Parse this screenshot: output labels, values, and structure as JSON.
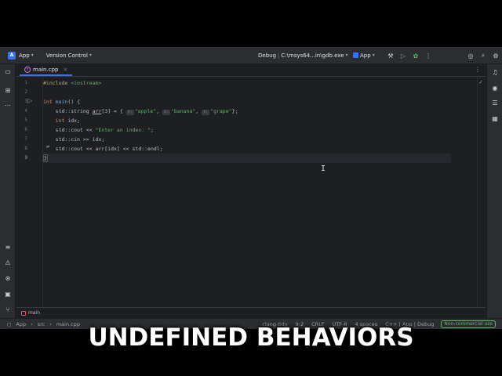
{
  "titlebar": {
    "app_badge": "A",
    "app_name": "App",
    "vcs": "Version Control",
    "config": "Debug",
    "config_path": "C:\\msys64...in\\gdb.exe",
    "target": "App"
  },
  "tabs": [
    {
      "label": "main.cpp",
      "icon": "cpp-file-icon"
    }
  ],
  "code": {
    "lines": [
      "1",
      "2",
      "3",
      "4",
      "5",
      "6",
      "7",
      "8",
      "9"
    ],
    "l1_pp": "#include",
    "l1_inc": "<iostream>",
    "l3_kw": "int",
    "l3_fn": "main",
    "l3_rest": "() {",
    "l4_a": "    std::string ",
    "l4_b": "arr",
    "l4_c": "[3] = { ",
    "hint_label": "s:",
    "s1": "\"apple\"",
    "s2": "\"banana\"",
    "s3": "\"grape\"",
    "l4_end": "};",
    "l5_kw": "int",
    "l5_rest": " idx;",
    "l6_a": "    std::cout << ",
    "l6_s": "\"Enter an index: \"",
    "l6_end": ";",
    "l7": "    std::cin >> idx;",
    "l8": "    std::cout << arr[idx] << std::endl;",
    "l9": "}"
  },
  "bottom_tab": {
    "label": "main"
  },
  "status": {
    "crumbs": [
      "App",
      "src",
      "main.cpp"
    ],
    "linter": ".clang-tidy",
    "position": "9:2",
    "line_sep": "CRLF",
    "encoding": "UTF-8",
    "indent": "4 spaces",
    "context": "C++ | App | Debug",
    "license": "Non-commercial use"
  },
  "caption": "UNDEFINED BEHAVIORS",
  "colors": {
    "accent": "#3574f0",
    "run": "#5fb865"
  }
}
